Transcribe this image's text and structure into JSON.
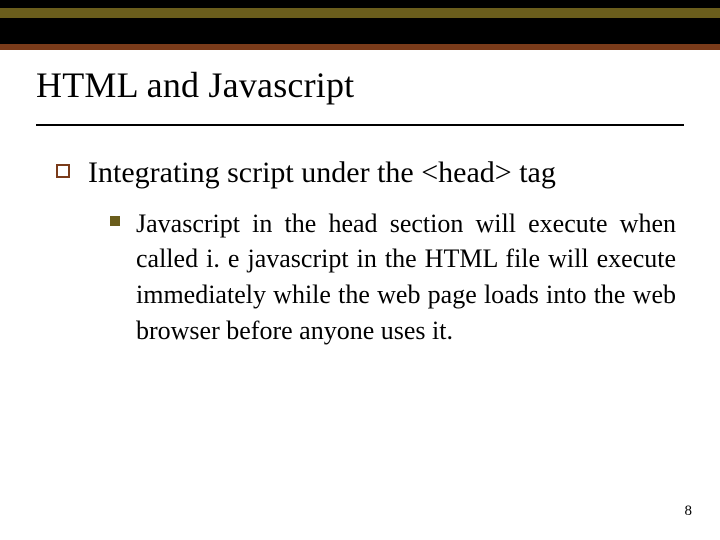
{
  "colors": {
    "olive": "#6a5d1c",
    "rust": "#7a3b1a",
    "black": "#000000"
  },
  "title": "HTML and Javascript",
  "bullet1": "Integrating script under the <head> tag",
  "bullet2": "Javascript in the head section will execute when called i. e javascript in the HTML file will execute immediately while the web page loads into the web browser before anyone uses it.",
  "page_number": "8"
}
